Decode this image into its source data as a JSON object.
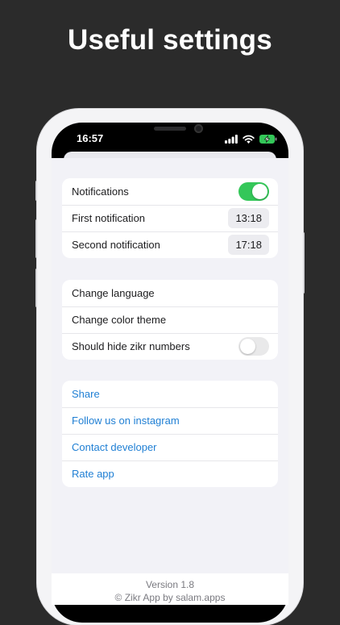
{
  "headline": "Useful settings",
  "status_bar": {
    "time": "16:57",
    "icons": [
      "cellular-signal-icon",
      "wifi-icon",
      "battery-charging-icon"
    ]
  },
  "notifications_group": {
    "notifications_label": "Notifications",
    "notifications_enabled": true,
    "first_label": "First notification",
    "first_time": "13:18",
    "second_label": "Second notification",
    "second_time": "17:18"
  },
  "preferences_group": {
    "language_label": "Change language",
    "theme_label": "Change color theme",
    "hide_numbers_label": "Should hide zikr numbers",
    "hide_numbers_enabled": false
  },
  "links_group": {
    "share": "Share",
    "instagram": "Follow us on instagram",
    "contact": "Contact developer",
    "rate": "Rate app"
  },
  "footer": {
    "version": "Version 1.8",
    "credit": "© Zikr App by salam.apps"
  },
  "colors": {
    "background": "#2b2b2b",
    "toggle_on": "#34c759",
    "link": "#1f7fd4"
  }
}
